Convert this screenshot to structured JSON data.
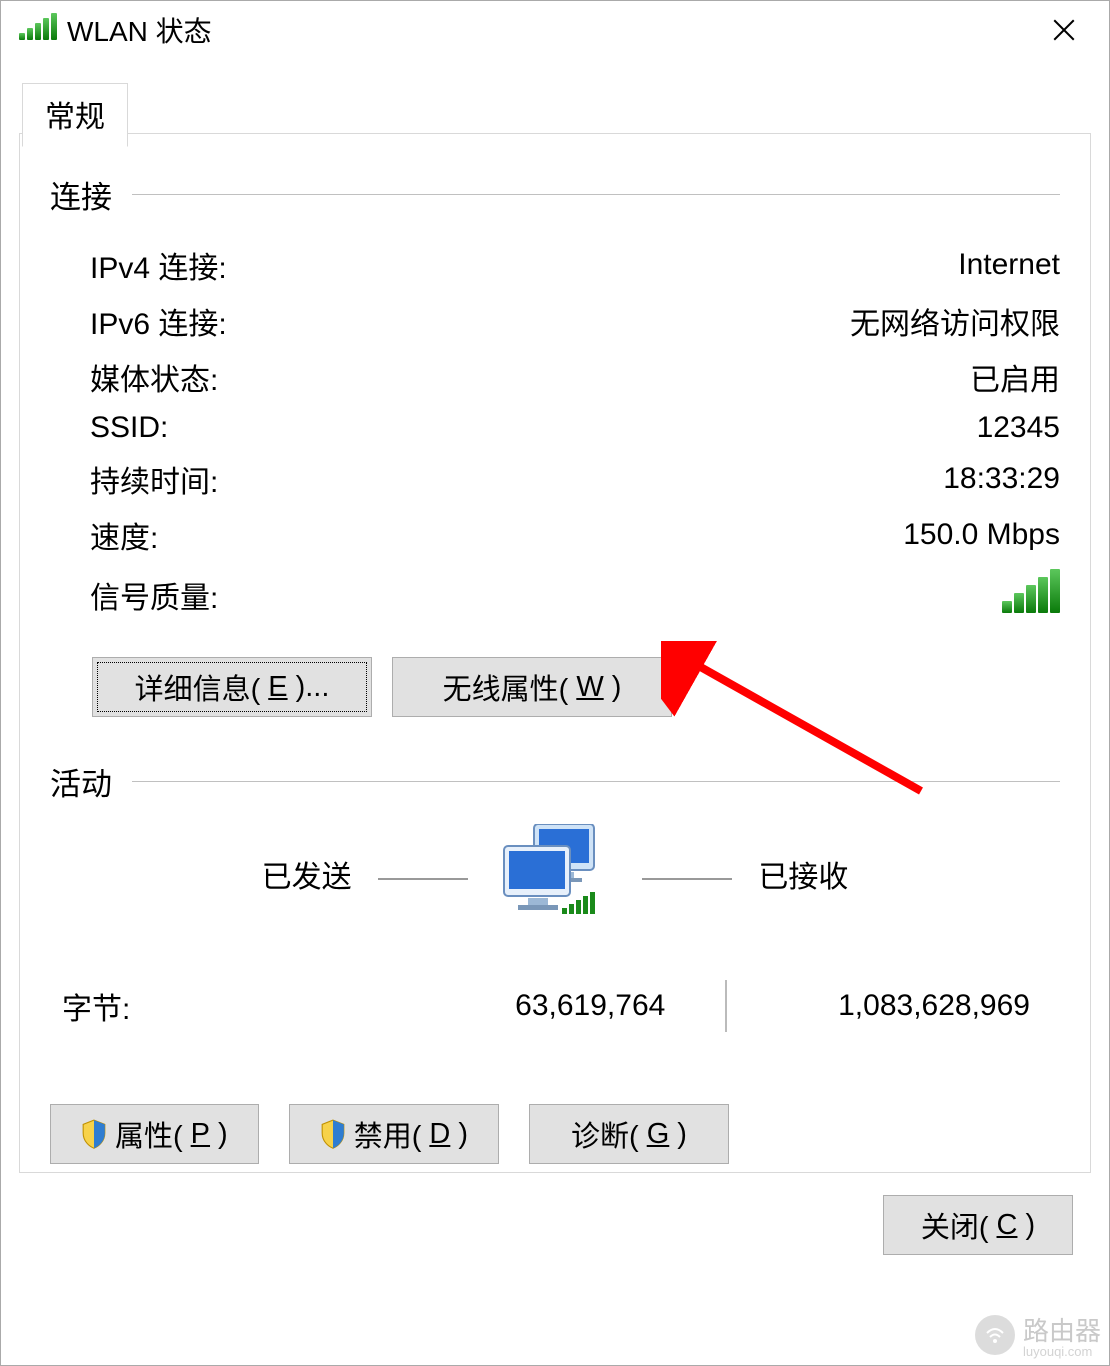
{
  "window": {
    "title": "WLAN 状态"
  },
  "tabs": {
    "general": "常规"
  },
  "connection": {
    "section_title": "连接",
    "ipv4_label": "IPv4 连接:",
    "ipv4_value": "Internet",
    "ipv6_label": "IPv6 连接:",
    "ipv6_value": "无网络访问权限",
    "media_label": "媒体状态:",
    "media_value": "已启用",
    "ssid_label": "SSID:",
    "ssid_value": "12345",
    "duration_label": "持续时间:",
    "duration_value": "18:33:29",
    "speed_label": "速度:",
    "speed_value": "150.0 Mbps",
    "signal_label": "信号质量:"
  },
  "buttons": {
    "details_prefix": "详细信息(",
    "details_key": "E",
    "details_suffix": ")...",
    "wireless_prefix": "无线属性(",
    "wireless_key": "W",
    "wireless_suffix": ")",
    "properties_prefix": "属性(",
    "properties_key": "P",
    "properties_suffix": ")",
    "disable_prefix": "禁用(",
    "disable_key": "D",
    "disable_suffix": ")",
    "diagnose_prefix": "诊断(",
    "diagnose_key": "G",
    "diagnose_suffix": ")",
    "close_prefix": "关闭(",
    "close_key": "C",
    "close_suffix": ")"
  },
  "activity": {
    "section_title": "活动",
    "sent_label": "已发送",
    "recv_label": "已接收",
    "bytes_label": "字节:",
    "bytes_sent": "63,619,764",
    "bytes_recv": "1,083,628,969"
  },
  "watermark": {
    "text": "路由器",
    "sub": "luyouqi.com"
  }
}
